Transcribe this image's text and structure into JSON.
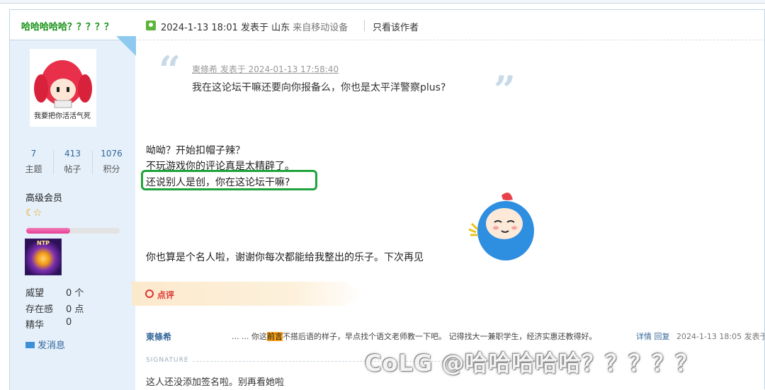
{
  "author": {
    "name": "哈哈哈哈哈？？？？？",
    "avatar_caption": "我要把你活活气死",
    "stats": [
      {
        "value": "7",
        "label": "主题"
      },
      {
        "value": "413",
        "label": "帖子"
      },
      {
        "value": "1076",
        "label": "积分"
      }
    ],
    "rank": "高级会员",
    "level_progress": 0.47,
    "medal_text": "NTP",
    "attributes": [
      {
        "key": "威望",
        "value": "0 个"
      },
      {
        "key": "存在感",
        "value": "0 点"
      },
      {
        "key": "精华",
        "value": "0"
      }
    ],
    "send_message": "发消息"
  },
  "post": {
    "meta": "2024-1-13 18:01 发表于 山东",
    "device": "来自移动设备",
    "only_author": "只看该作者",
    "quote": {
      "author_line": "東條希 发表于 2024-01-13 17:58:40",
      "text": "我在这论坛干嘛还要向你报备么，你也是太平洋警察plus?"
    },
    "body_lines": [
      "呦呦？开始扣帽子辣？",
      "不玩游戏你的评论真是太精辟了。",
      "还说别人是创，你在这论坛干嘛?",
      "你也算是个名人啦，谢谢你每次都能给我整出的乐子。下次再见"
    ]
  },
  "comment_section": {
    "label": "点评",
    "comment": {
      "user": "東條希",
      "text_before": "... ... 你这",
      "text_mark": "前言",
      "text_after": "不搭后语的样子，早点找个语文老师教一下吧。 记得找大一兼职学生，经济实惠还教得好。",
      "links": "详情 回复",
      "time": "2024-1-13 18:05 发表于"
    }
  },
  "signature": {
    "label": "SIGNATURE",
    "text": "这人还没添加签名啦。别再看她啦"
  },
  "watermark": "CoLG @哈哈哈哈哈？？？？？",
  "colors": {
    "accent_green": "#109010",
    "link_blue": "#336699",
    "highlight_green": "#1fa33a",
    "comment_red": "#dd3333",
    "mark_orange": "#f7a21b"
  }
}
